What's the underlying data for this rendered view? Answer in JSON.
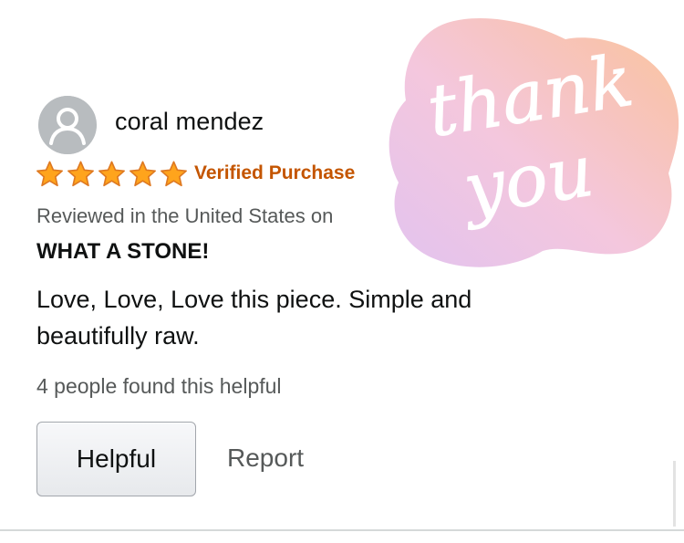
{
  "review": {
    "reviewer_name": "coral mendez",
    "rating": 5,
    "rating_max": 5,
    "verified_label": "Verified Purchase",
    "meta": "Reviewed in the United States on",
    "title": "WHAT A STONE!",
    "body": "Love, Love, Love this piece. Simple and beautifully raw.",
    "helpful_count_text": "4 people found this helpful"
  },
  "actions": {
    "helpful_label": "Helpful",
    "report_label": "Report"
  },
  "sticker": {
    "line1": "thank",
    "line2": "you"
  },
  "icons": {
    "avatar": "user-avatar-icon",
    "star": "star-icon"
  },
  "colors": {
    "star": "#ffa41c",
    "star_stroke": "#de7921",
    "verified": "#c45500",
    "muted_text": "#565959",
    "text": "#0f1111",
    "avatar_bg": "#b8bcbf"
  }
}
